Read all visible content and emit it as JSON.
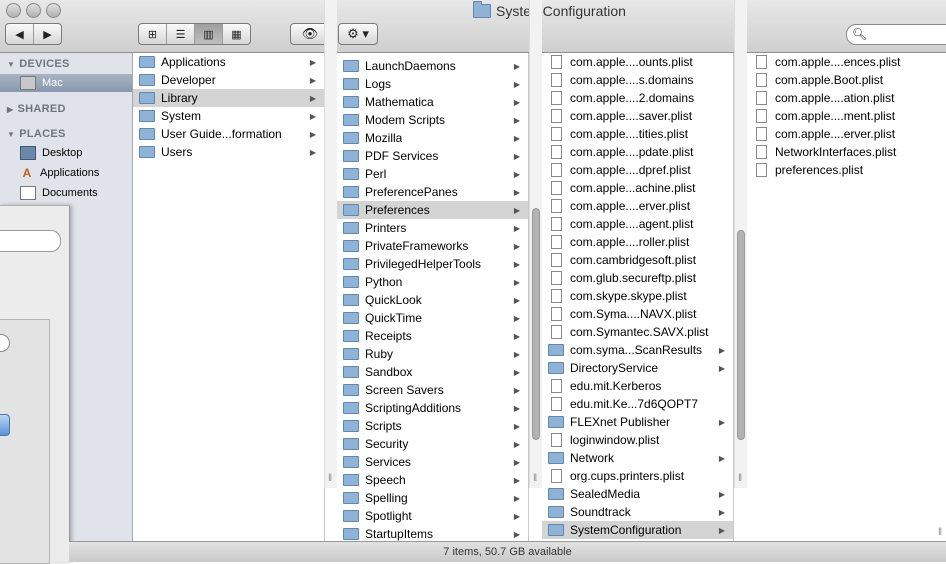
{
  "window": {
    "title": "SystemConfiguration"
  },
  "toolbar": {
    "back": "◀",
    "forward": "▶",
    "view_icons": "⊞",
    "view_list": "☰",
    "view_columns": "▥",
    "view_coverflow": "▦",
    "quicklook": "👁",
    "action": "⚙ ▾",
    "search_placeholder": ""
  },
  "sidebar": {
    "devices_header": "DEVICES",
    "shared_header": "SHARED",
    "places_header": "PLACES",
    "devices": [
      {
        "label": "Mac",
        "icon": "computer-icon"
      }
    ],
    "places": [
      {
        "label": "Desktop",
        "icon": "desktop-icon"
      },
      {
        "label": "Applications",
        "icon": "applications-icon"
      },
      {
        "label": "Documents",
        "icon": "documents-icon"
      }
    ]
  },
  "columns": [
    {
      "items": [
        {
          "name": "Applications",
          "folder": true
        },
        {
          "name": "Developer",
          "folder": true
        },
        {
          "name": "Library",
          "folder": true,
          "selected": true
        },
        {
          "name": "System",
          "folder": true
        },
        {
          "name": "User Guide...formation",
          "folder": true
        },
        {
          "name": "Users",
          "folder": true
        }
      ]
    },
    {
      "items": [
        {
          "name": "LaunchDaemons",
          "folder": true
        },
        {
          "name": "Logs",
          "folder": true
        },
        {
          "name": "Mathematica",
          "folder": true
        },
        {
          "name": "Modem Scripts",
          "folder": true
        },
        {
          "name": "Mozilla",
          "folder": true
        },
        {
          "name": "PDF Services",
          "folder": true
        },
        {
          "name": "Perl",
          "folder": true
        },
        {
          "name": "PreferencePanes",
          "folder": true
        },
        {
          "name": "Preferences",
          "folder": true,
          "selected": true
        },
        {
          "name": "Printers",
          "folder": true
        },
        {
          "name": "PrivateFrameworks",
          "folder": true
        },
        {
          "name": "PrivilegedHelperTools",
          "folder": true
        },
        {
          "name": "Python",
          "folder": true
        },
        {
          "name": "QuickLook",
          "folder": true
        },
        {
          "name": "QuickTime",
          "folder": true
        },
        {
          "name": "Receipts",
          "folder": true
        },
        {
          "name": "Ruby",
          "folder": true
        },
        {
          "name": "Sandbox",
          "folder": true
        },
        {
          "name": "Screen Savers",
          "folder": true
        },
        {
          "name": "ScriptingAdditions",
          "folder": true
        },
        {
          "name": "Scripts",
          "folder": true
        },
        {
          "name": "Security",
          "folder": true
        },
        {
          "name": "Services",
          "folder": true
        },
        {
          "name": "Speech",
          "folder": true
        },
        {
          "name": "Spelling",
          "folder": true
        },
        {
          "name": "Spotlight",
          "folder": true
        },
        {
          "name": "StartupItems",
          "folder": true
        }
      ]
    },
    {
      "items": [
        {
          "name": "com.apple....ounts.plist",
          "folder": false
        },
        {
          "name": "com.apple....s.domains",
          "folder": false
        },
        {
          "name": "com.apple....2.domains",
          "folder": false
        },
        {
          "name": "com.apple....saver.plist",
          "folder": false
        },
        {
          "name": "com.apple....tities.plist",
          "folder": false
        },
        {
          "name": "com.apple....pdate.plist",
          "folder": false
        },
        {
          "name": "com.apple....dpref.plist",
          "folder": false
        },
        {
          "name": "com.apple...achine.plist",
          "folder": false
        },
        {
          "name": "com.apple....erver.plist",
          "folder": false
        },
        {
          "name": "com.apple....agent.plist",
          "folder": false
        },
        {
          "name": "com.apple....roller.plist",
          "folder": false
        },
        {
          "name": "com.cambridgesoft.plist",
          "folder": false
        },
        {
          "name": "com.glub.secureftp.plist",
          "folder": false
        },
        {
          "name": "com.skype.skype.plist",
          "folder": false
        },
        {
          "name": "com.Syma....NAVX.plist",
          "folder": false
        },
        {
          "name": "com.Symantec.SAVX.plist",
          "folder": false
        },
        {
          "name": "com.syma...ScanResults",
          "folder": true
        },
        {
          "name": "DirectoryService",
          "folder": true
        },
        {
          "name": "edu.mit.Kerberos",
          "folder": false
        },
        {
          "name": "edu.mit.Ke...7d6QOPT7",
          "folder": false
        },
        {
          "name": "FLEXnet Publisher",
          "folder": true
        },
        {
          "name": "loginwindow.plist",
          "folder": false
        },
        {
          "name": "Network",
          "folder": true
        },
        {
          "name": "org.cups.printers.plist",
          "folder": false
        },
        {
          "name": "SealedMedia",
          "folder": true
        },
        {
          "name": "Soundtrack",
          "folder": true
        },
        {
          "name": "SystemConfiguration",
          "folder": true,
          "selected": true
        }
      ]
    },
    {
      "items": [
        {
          "name": "com.apple....ences.plist",
          "folder": false
        },
        {
          "name": "com.apple.Boot.plist",
          "folder": false
        },
        {
          "name": "com.apple....ation.plist",
          "folder": false
        },
        {
          "name": "com.apple....ment.plist",
          "folder": false
        },
        {
          "name": "com.apple....erver.plist",
          "folder": false
        },
        {
          "name": "NetworkInterfaces.plist",
          "folder": false
        },
        {
          "name": "preferences.plist",
          "folder": false
        }
      ]
    }
  ],
  "status": {
    "text": "7 items, 50.7 GB available"
  }
}
